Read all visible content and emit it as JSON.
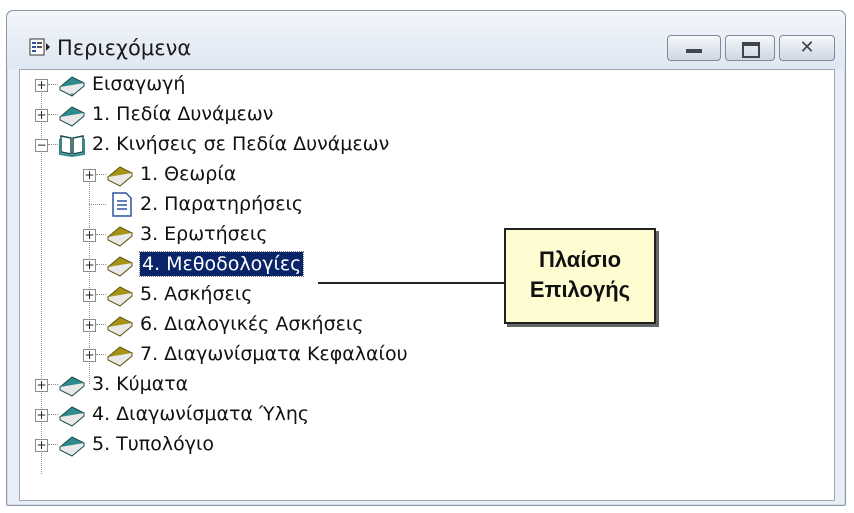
{
  "window": {
    "title": "Περιεχόμενα",
    "buttons": {
      "minimize": "minimize",
      "maximize": "maximize",
      "close": "✕"
    }
  },
  "tree": {
    "items": [
      {
        "label": "Εισαγωγή",
        "icon": "book-closed-icon"
      },
      {
        "label": "1. Πεδία Δυνάμεων",
        "icon": "book-closed-icon"
      },
      {
        "label": "2. Κινήσεις σε Πεδία Δυνάμεων",
        "icon": "book-open-icon"
      },
      {
        "label": "1. Θεωρία",
        "icon": "book-closed-icon"
      },
      {
        "label": "2. Παρατηρήσεις",
        "icon": "page-icon"
      },
      {
        "label": "3. Ερωτήσεις",
        "icon": "book-closed-icon"
      },
      {
        "label": "4. Μεθοδολογίες",
        "icon": "book-closed-icon",
        "selected": true
      },
      {
        "label": "5. Ασκήσεις",
        "icon": "book-closed-icon"
      },
      {
        "label": "6. Διαλογικές Ασκήσεις",
        "icon": "book-closed-icon"
      },
      {
        "label": "7. Διαγωνίσματα Κεφαλαίου",
        "icon": "book-closed-icon"
      },
      {
        "label": "3. Κύματα",
        "icon": "book-closed-icon"
      },
      {
        "label": "4. Διαγωνίσματα Ύλης",
        "icon": "book-closed-icon"
      },
      {
        "label": "5. Τυπολόγιο",
        "icon": "book-closed-icon"
      }
    ]
  },
  "callout": {
    "line1": "Πλαίσιο",
    "line2": "Επιλογής"
  },
  "colors": {
    "selection": "#0a246a",
    "callout_bg": "#fefdd2",
    "book_teal": "#2f8b8d",
    "book_olive": "#a79318"
  }
}
